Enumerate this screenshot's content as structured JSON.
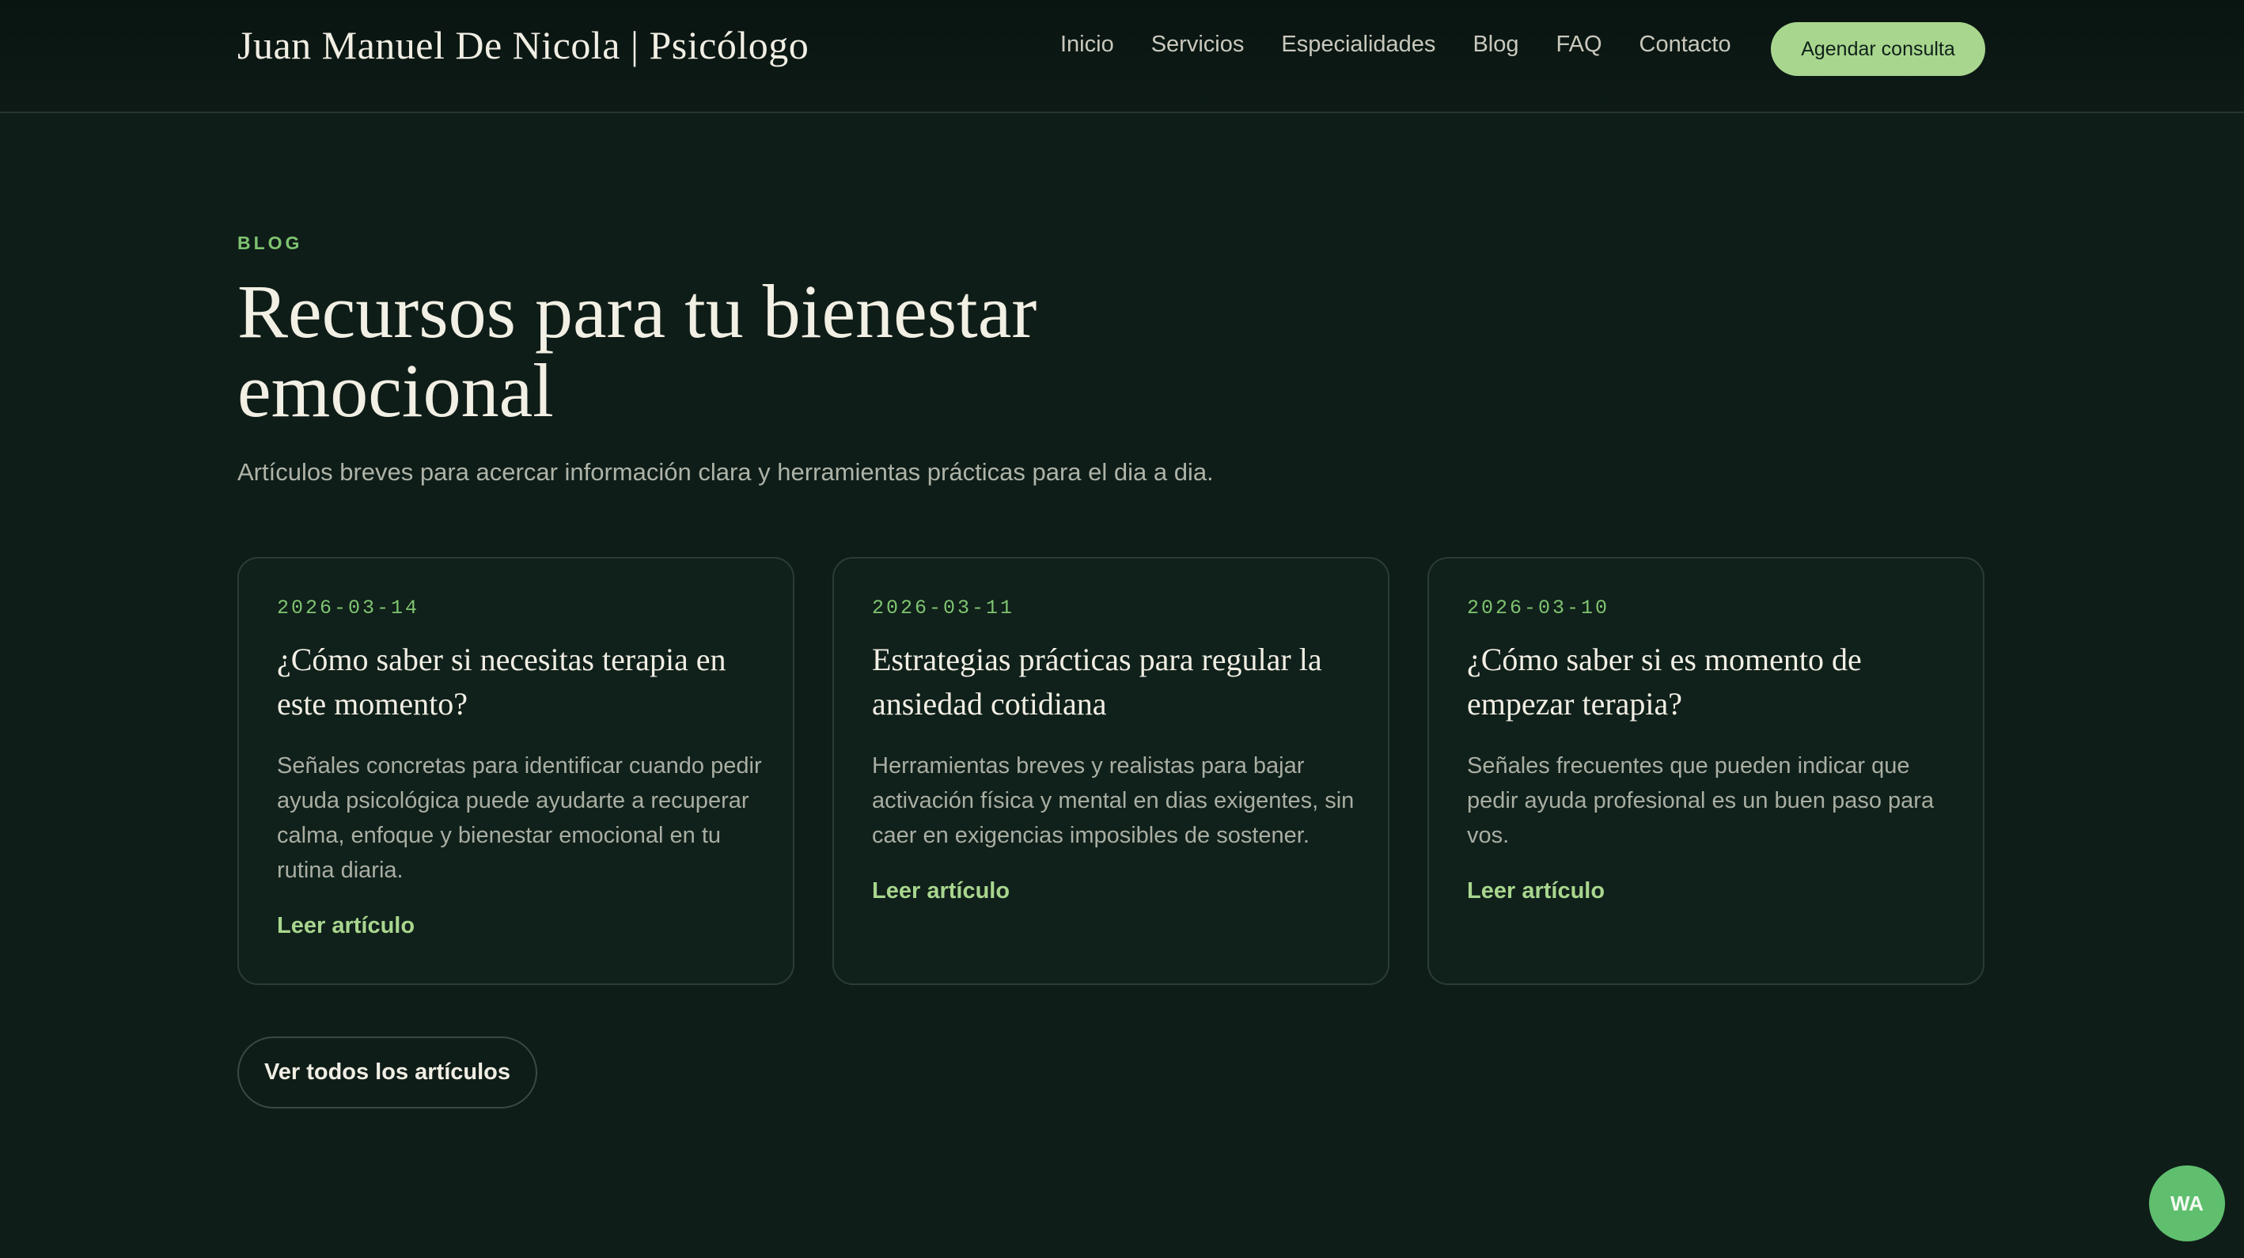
{
  "header": {
    "brand": "Juan Manuel De Nicola | Psicólogo",
    "nav": [
      "Inicio",
      "Servicios",
      "Especialidades",
      "Blog",
      "FAQ",
      "Contacto"
    ],
    "cta": "Agendar consulta"
  },
  "hero": {
    "eyebrow": "BLOG",
    "title": "Recursos para tu bienestar emocional",
    "subtitle": "Artículos breves para acercar información clara y herramientas prácticas para el dia a dia."
  },
  "cards": [
    {
      "date": "2026-03-14",
      "title": "¿Cómo saber si necesitas terapia en este momento?",
      "excerpt": "Señales concretas para identificar cuando pedir ayuda psicológica puede ayudarte a recuperar calma, enfoque y bienestar emocional en tu rutina diaria.",
      "link": "Leer artículo"
    },
    {
      "date": "2026-03-11",
      "title": "Estrategias prácticas para regular la ansiedad cotidiana",
      "excerpt": "Herramientas breves y realistas para bajar activación física y mental en dias exigentes, sin caer en exigencias imposibles de sostener.",
      "link": "Leer artículo"
    },
    {
      "date": "2026-03-10",
      "title": "¿Cómo saber si es momento de empezar terapia?",
      "excerpt": "Señales frecuentes que pueden indicar que pedir ayuda profesional es un buen paso para vos.",
      "link": "Leer artículo"
    }
  ],
  "all_articles": "Ver todos los artículos",
  "whatsapp": "WA",
  "colors": {
    "background": "#0f1d18",
    "accent": "#a8d68e",
    "eyebrow": "#7fc471",
    "whatsapp": "#5fbf6e"
  }
}
